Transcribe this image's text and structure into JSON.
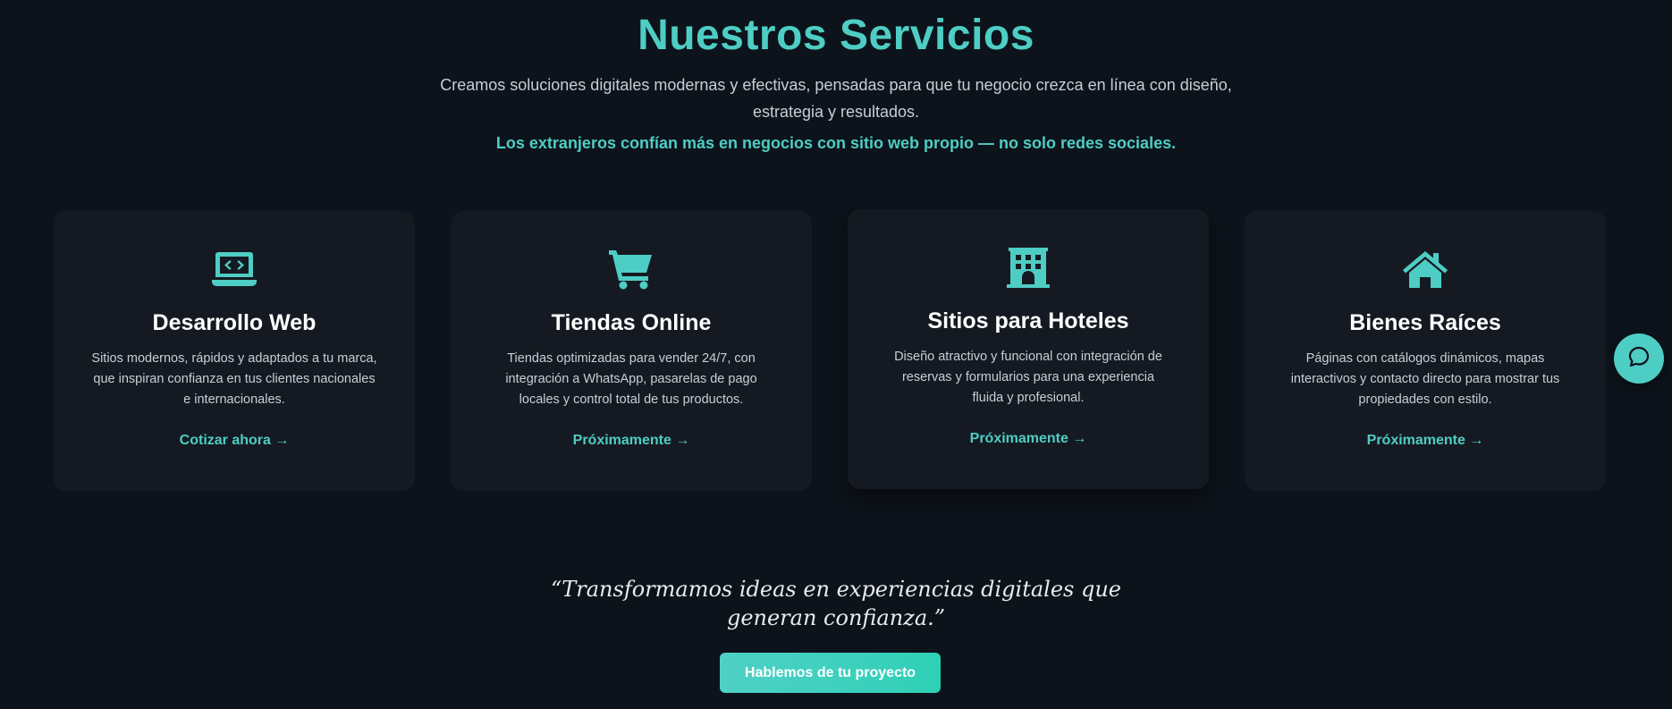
{
  "section": {
    "title": "Nuestros Servicios",
    "subtitle": "Creamos soluciones digitales modernas y efectivas, pensadas para que tu negocio crezca en línea con diseño, estrategia y resultados.",
    "highlight": "Los extranjeros confían más en negocios con sitio web propio — no solo redes sociales."
  },
  "colors": {
    "accent": "#4ecdc4",
    "background": "#0d131b",
    "card": "#151a22"
  },
  "cards": [
    {
      "icon": "laptop-code-icon",
      "title": "Desarrollo Web",
      "description": "Sitios modernos, rápidos y adaptados a tu marca, que inspiran confianza en tus clientes nacionales e internacionales.",
      "link": "Cotizar ahora →"
    },
    {
      "icon": "shopping-cart-icon",
      "title": "Tiendas Online",
      "description": "Tiendas optimizadas para vender 24/7, con integración a WhatsApp, pasarelas de pago locales y control total de tus productos.",
      "link": "Próximamente →"
    },
    {
      "icon": "hotel-icon",
      "title": "Sitios para Hoteles",
      "description": "Diseño atractivo y funcional con integración de reservas y formularios para una experiencia fluida y profesional.",
      "link": "Próximamente →"
    },
    {
      "icon": "house-icon",
      "title": "Bienes Raíces",
      "description": "Páginas con catálogos dinámicos, mapas interactivos y contacto directo para mostrar tus propiedades con estilo.",
      "link": "Próximamente →"
    }
  ],
  "quote": "“Transformamos ideas en experiencias digitales que generan confianza.”",
  "cta": {
    "label": "Hablemos de tu proyecto"
  },
  "chat": {
    "icon": "chat-bubble-icon"
  }
}
